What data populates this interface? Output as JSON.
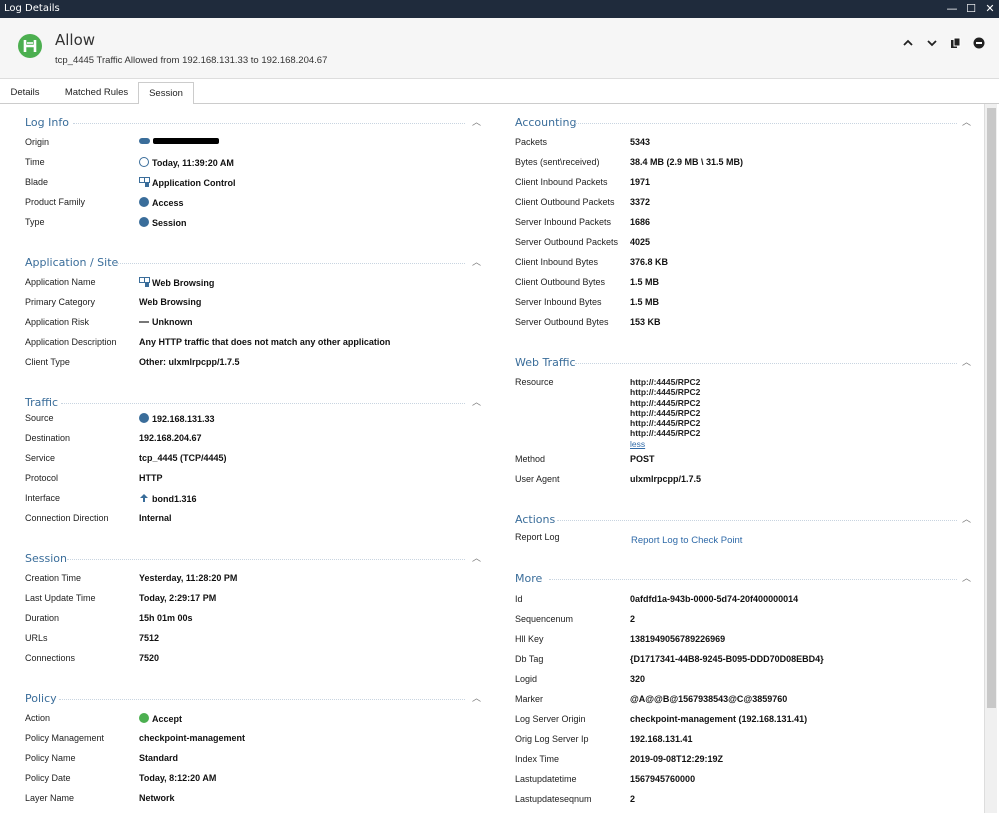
{
  "window": {
    "title": "Log Details",
    "minimize": "—",
    "maximize": "☐",
    "close": "✕"
  },
  "header": {
    "status": "Allow",
    "subtitle": "tcp_4445 Traffic Allowed from 192.168.131.33 to 192.168.204.67",
    "colors": {
      "status_green": "#4caf50"
    }
  },
  "tabs": [
    {
      "label": "Details"
    },
    {
      "label": "Matched Rules"
    },
    {
      "label": "Session",
      "active": true
    }
  ],
  "left": {
    "log_info": {
      "title": "Log Info",
      "rows": [
        {
          "label": "Origin",
          "value": "",
          "icon": "gateway-icon"
        },
        {
          "label": "Time",
          "value": "Today, 11:39:20 AM",
          "icon": "clock-icon"
        },
        {
          "label": "Blade",
          "value": "Application Control",
          "icon": "app-control-icon"
        },
        {
          "label": "Product Family",
          "value": "Access",
          "icon": "access-icon"
        },
        {
          "label": "Type",
          "value": "Session",
          "icon": "session-icon"
        }
      ]
    },
    "application": {
      "title": "Application / Site",
      "rows": [
        {
          "label": "Application Name",
          "value": "Web Browsing",
          "icon": "app-grid-icon"
        },
        {
          "label": "Primary Category",
          "value": "Web Browsing"
        },
        {
          "label": "Application Risk",
          "value": "Unknown",
          "icon": "risk-dash-icon"
        },
        {
          "label": "Application Description",
          "value": "Any HTTP traffic that does not match any other application"
        },
        {
          "label": "Client Type",
          "value": "Other: ulxmlrpcpp/1.7.5"
        }
      ]
    },
    "traffic": {
      "title": "Traffic",
      "rows": [
        {
          "label": "Source",
          "value": "192.168.131.33",
          "icon": "globe-icon"
        },
        {
          "label": "Destination",
          "value": "192.168.204.67"
        },
        {
          "label": "Service",
          "value": "tcp_4445 (TCP/4445)"
        },
        {
          "label": "Protocol",
          "value": "HTTP"
        },
        {
          "label": "Interface",
          "value": "bond1.316",
          "icon": "upload-arrow-icon"
        },
        {
          "label": "Connection Direction",
          "value": "Internal"
        }
      ]
    },
    "session": {
      "title": "Session",
      "rows": [
        {
          "label": "Creation Time",
          "value": "Yesterday, 11:28:20 PM"
        },
        {
          "label": "Last Update Time",
          "value": "Today, 2:29:17 PM"
        },
        {
          "label": "Duration",
          "value": "15h 01m 00s"
        },
        {
          "label": "URLs",
          "value": "7512"
        },
        {
          "label": "Connections",
          "value": "7520"
        }
      ]
    },
    "policy": {
      "title": "Policy",
      "rows": [
        {
          "label": "Action",
          "value": "Accept",
          "icon": "accept-icon"
        },
        {
          "label": "Policy Management",
          "value": "checkpoint-management"
        },
        {
          "label": "Policy Name",
          "value": "Standard"
        },
        {
          "label": "Policy Date",
          "value": "Today, 8:12:20 AM"
        },
        {
          "label": "Layer Name",
          "value": "Network"
        }
      ]
    }
  },
  "right": {
    "accounting": {
      "title": "Accounting",
      "rows": [
        {
          "label": "Packets",
          "value": "5343"
        },
        {
          "label": "Bytes (sent\\received)",
          "value": "38.4 MB (2.9 MB \\ 31.5 MB)"
        },
        {
          "label": "Client Inbound Packets",
          "value": "1971"
        },
        {
          "label": "Client Outbound Packets",
          "value": "3372"
        },
        {
          "label": "Server Inbound Packets",
          "value": "1686"
        },
        {
          "label": "Server Outbound Packets",
          "value": "4025"
        },
        {
          "label": "Client Inbound Bytes",
          "value": "376.8 KB"
        },
        {
          "label": "Client Outbound Bytes",
          "value": "1.5 MB"
        },
        {
          "label": "Server Inbound Bytes",
          "value": "1.5 MB"
        },
        {
          "label": "Server Outbound Bytes",
          "value": "153 KB"
        }
      ]
    },
    "web_traffic": {
      "title": "Web Traffic",
      "resource_label": "Resource",
      "resources": [
        "http://:4445/RPC2",
        "http://:4445/RPC2",
        "http://:4445/RPC2",
        "http://:4445/RPC2",
        "http://:4445/RPC2",
        "http://:4445/RPC2"
      ],
      "less_link": "less",
      "rows": [
        {
          "label": "Method",
          "value": "POST"
        },
        {
          "label": "User Agent",
          "value": "ulxmlrpcpp/1.7.5"
        }
      ]
    },
    "actions": {
      "title": "Actions",
      "report_label": "Report Log",
      "report_link": "Report Log to Check Point"
    },
    "more": {
      "title": "More",
      "rows": [
        {
          "label": "Id",
          "value": "0afdfd1a-943b-0000-5d74-20f400000014"
        },
        {
          "label": "Sequencenum",
          "value": "2"
        },
        {
          "label": "Hll Key",
          "value": "1381949056789226969"
        },
        {
          "label": "Db Tag",
          "value": "{D1717341-44B8-9245-B095-DDD70D08EBD4}"
        },
        {
          "label": "Logid",
          "value": "320"
        },
        {
          "label": "Marker",
          "value": "@A@@B@1567938543@C@3859760"
        },
        {
          "label": "Log Server Origin",
          "value": "checkpoint-management (192.168.131.41)"
        },
        {
          "label": "Orig Log Server Ip",
          "value": "192.168.131.41"
        },
        {
          "label": "Index Time",
          "value": "2019-09-08T12:29:19Z"
        },
        {
          "label": "Lastupdatetime",
          "value": "1567945760000"
        },
        {
          "label": "Lastupdateseqnum",
          "value": "2"
        }
      ]
    }
  }
}
